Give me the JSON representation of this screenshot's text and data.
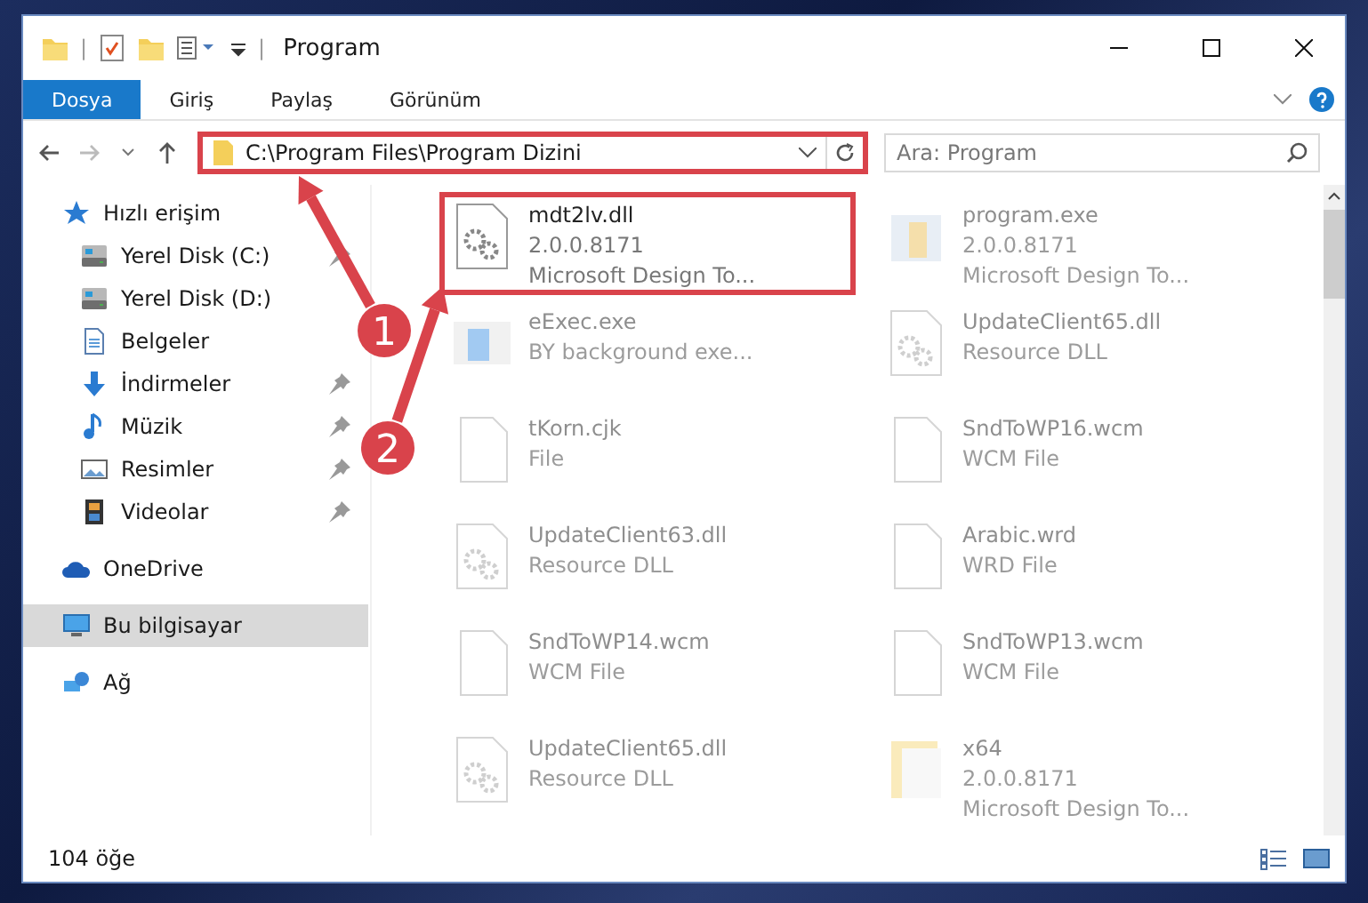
{
  "window": {
    "title": "Program",
    "quick_access_separator": "|"
  },
  "ribbon": {
    "tabs": [
      {
        "label": "Dosya",
        "selected": true
      },
      {
        "label": "Giriş",
        "selected": false
      },
      {
        "label": "Paylaş",
        "selected": false
      },
      {
        "label": "Görünüm",
        "selected": false
      }
    ]
  },
  "address_bar": {
    "path": "C:\\Program Files\\Program Dizini",
    "highlighted": true
  },
  "search": {
    "placeholder": "Ara: Program"
  },
  "sidebar": {
    "items": [
      {
        "label": "Hızlı erişim",
        "kind": "star",
        "selected": false,
        "children": [
          {
            "label": "Yerel Disk (C:)",
            "kind": "drive",
            "pinned": true,
            "selected": false
          },
          {
            "label": "Yerel Disk (D:)",
            "kind": "drive",
            "pinned": false,
            "selected": false
          },
          {
            "label": "Belgeler",
            "kind": "document",
            "pinned": false,
            "selected": false
          },
          {
            "label": "İndirmeler",
            "kind": "download",
            "pinned": true,
            "selected": false
          },
          {
            "label": "Müzik",
            "kind": "music",
            "pinned": true,
            "selected": false
          },
          {
            "label": "Resimler",
            "kind": "pictures",
            "pinned": true,
            "selected": false
          },
          {
            "label": "Videolar",
            "kind": "video",
            "pinned": true,
            "selected": false
          }
        ]
      },
      {
        "label": "OneDrive",
        "kind": "cloud",
        "selected": false
      },
      {
        "label": "Bu bilgisayar",
        "kind": "computer",
        "selected": true
      },
      {
        "label": "Ağ",
        "kind": "network",
        "selected": false
      }
    ]
  },
  "files": [
    {
      "name": "mdt2lv.dll",
      "lines": [
        "2.0.0.8171",
        "Microsoft Design To..."
      ],
      "kind": "dll",
      "faded": false,
      "highlighted": true
    },
    {
      "name": "program.exe",
      "lines": [
        "2.0.0.8171",
        "Microsoft Design To..."
      ],
      "kind": "exe",
      "faded": true,
      "highlighted": false
    },
    {
      "name": "eExec.exe",
      "lines": [
        "BY background exe..."
      ],
      "kind": "app",
      "faded": true,
      "highlighted": false
    },
    {
      "name": "UpdateClient65.dll",
      "lines": [
        "Resource DLL"
      ],
      "kind": "dll",
      "faded": true,
      "highlighted": false
    },
    {
      "name": "tKorn.cjk",
      "lines": [
        "File"
      ],
      "kind": "file",
      "faded": true,
      "highlighted": false
    },
    {
      "name": "SndToWP16.wcm",
      "lines": [
        "WCM File"
      ],
      "kind": "file",
      "faded": true,
      "highlighted": false
    },
    {
      "name": "UpdateClient63.dll",
      "lines": [
        "Resource DLL"
      ],
      "kind": "dll",
      "faded": true,
      "highlighted": false
    },
    {
      "name": "Arabic.wrd",
      "lines": [
        "WRD File"
      ],
      "kind": "file",
      "faded": true,
      "highlighted": false
    },
    {
      "name": "SndToWP14.wcm",
      "lines": [
        "WCM File"
      ],
      "kind": "file",
      "faded": true,
      "highlighted": false
    },
    {
      "name": "SndToWP13.wcm",
      "lines": [
        "WCM File"
      ],
      "kind": "file",
      "faded": true,
      "highlighted": false
    },
    {
      "name": "UpdateClient65.dll",
      "lines": [
        "Resource DLL"
      ],
      "kind": "dll",
      "faded": true,
      "highlighted": false
    },
    {
      "name": "x64",
      "lines": [
        "2.0.0.8171",
        "Microsoft Design To..."
      ],
      "kind": "folder",
      "faded": true,
      "highlighted": false
    }
  ],
  "status_bar": {
    "item_count": "104 öğe"
  },
  "annotations": [
    {
      "label": "1"
    },
    {
      "label": "2"
    }
  ]
}
